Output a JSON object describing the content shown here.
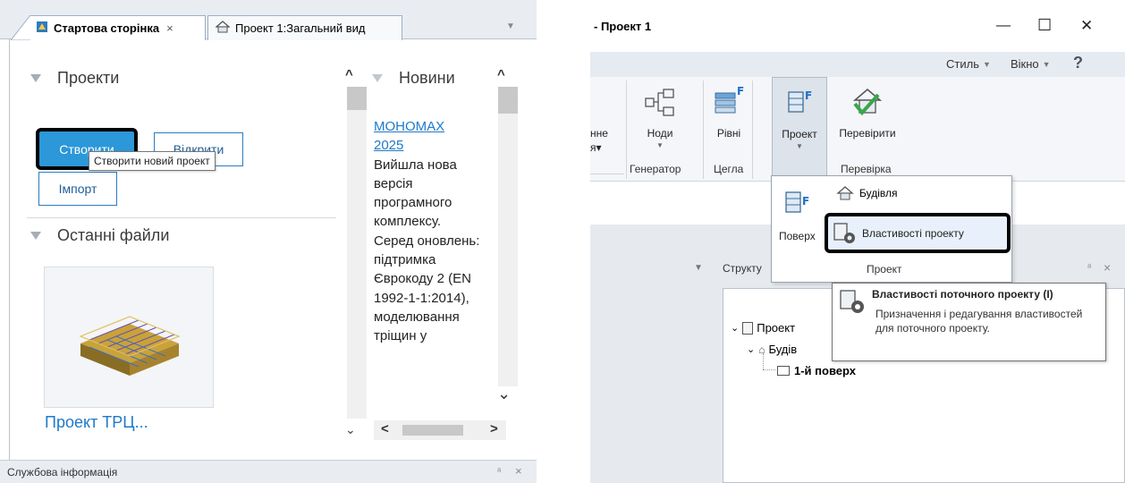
{
  "left": {
    "tabs": [
      {
        "label": "Стартова сторінка",
        "close": "×"
      },
      {
        "label": "Проект 1:Загальний вид"
      }
    ],
    "projects": {
      "header": "Проекти",
      "create_label": "Створити",
      "open_label": "Відкрити",
      "import_label": "Імпорт",
      "create_tooltip": "Створити новий проект"
    },
    "recent": {
      "header": "Останні файли",
      "item_label": "Проект ТРЦ..."
    },
    "news": {
      "header": "Новини",
      "link": "МОНОМАХ 2025",
      "body": "Вийшла нова версія програмного комплексу. Серед оновлень: підтримка Єврокоду 2 (EN 1992-1-1:2014), моделювання тріщин у"
    },
    "status_bar": "Службова інформація",
    "status_pin": "ᵃ",
    "status_close": "×"
  },
  "right": {
    "title": "- Проект 1",
    "window_buttons": {
      "minimize": "—",
      "maximize": "☐",
      "close": "✕"
    },
    "menu": {
      "style": "Стиль",
      "window": "Вікно",
      "help": "?"
    },
    "ribbon": {
      "partial_label": "нне",
      "partial_label2": "я▾",
      "nodes": "Ноди",
      "levels": "Рівні",
      "project": "Проект",
      "check": "Перевірити",
      "groups": {
        "generator": "Генератор",
        "brick": "Цегла",
        "check": "Перевірка"
      }
    },
    "dropdown": {
      "building": "Будівля",
      "properties": "Властивості проекту",
      "floor_partial": "Поверх",
      "group": "Проект"
    },
    "structure_label": "Структу",
    "tree": {
      "project": "Проект",
      "building": "Будів",
      "floor": "1-й поверх"
    },
    "tooltip": {
      "title": "Властивості поточного проекту (I)",
      "body": "Призначення і редагування властивостей для поточного проекту."
    },
    "pane_pin": "ᵃ",
    "pane_close": "×"
  },
  "colors": {
    "accent": "#2c97d9",
    "link": "#1e79c9",
    "ribbon_bg": "#f4f6f9"
  }
}
